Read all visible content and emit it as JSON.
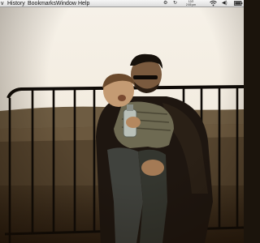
{
  "menubar": {
    "items": [
      {
        "label": "v"
      },
      {
        "label": "History"
      },
      {
        "label": "Bookmarks"
      },
      {
        "label": "Window"
      },
      {
        "label": "Help"
      }
    ],
    "status": {
      "icons": [
        "gear-icon",
        "sync-icon",
        "wifi-icon",
        "volume-icon"
      ],
      "clock_line1": "12/2",
      "clock_line2": "2:55 pm"
    }
  },
  "colors": {
    "sky": "#f4efe6",
    "fence": "#0d0b08",
    "wall": "#5a4a36",
    "ground": "#3a2c1c",
    "jacket": "#22190f"
  }
}
